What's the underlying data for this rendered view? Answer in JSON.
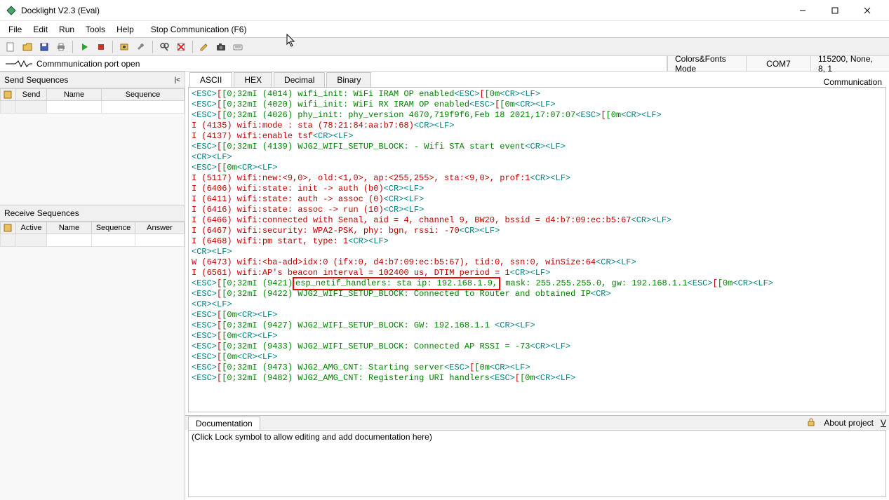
{
  "window": {
    "title": "Docklight V2.3 (Eval)"
  },
  "menubar": [
    "File",
    "Edit",
    "Run",
    "Tools",
    "Help"
  ],
  "stop_comm": "Stop Communication  (F6)",
  "status": {
    "port_open": "Commmunication port open",
    "colors_mode": "Colors&Fonts Mode",
    "port": "COM7",
    "settings": "115200, None, 8, 1"
  },
  "left": {
    "send_header": "Send Sequences",
    "recv_header": "Receive Sequences",
    "send_cols": {
      "c1": "Send",
      "c2": "Name",
      "c3": "Sequence"
    },
    "recv_cols": {
      "c1": "Active",
      "c2": "Name",
      "c3": "Sequence",
      "c4": "Answer"
    }
  },
  "tabs": [
    "ASCII",
    "HEX",
    "Decimal",
    "Binary"
  ],
  "active_tab": 0,
  "right_label": "Communication",
  "doc": {
    "tab": "Documentation",
    "about": "About project",
    "v": "V",
    "placeholder": "(Click Lock symbol to allow editing and add documentation here)"
  },
  "log": [
    {
      "segments": [
        {
          "t": "<ESC>",
          "c": "cyan"
        },
        {
          "t": "[",
          "c": "red"
        },
        {
          "t": "[0;32mI (4014) wifi_init: WiFi IRAM OP enabled",
          "c": "green"
        },
        {
          "t": "<ESC>",
          "c": "cyan"
        },
        {
          "t": "[",
          "c": "red"
        },
        {
          "t": "[0m",
          "c": "green"
        },
        {
          "t": "<CR><LF>",
          "c": "cyan"
        }
      ]
    },
    {
      "segments": [
        {
          "t": "<ESC>",
          "c": "cyan"
        },
        {
          "t": "[",
          "c": "red"
        },
        {
          "t": "[0;32mI (4020) wifi_init: WiFi RX IRAM OP enabled",
          "c": "green"
        },
        {
          "t": "<ESC>",
          "c": "cyan"
        },
        {
          "t": "[",
          "c": "red"
        },
        {
          "t": "[0m",
          "c": "green"
        },
        {
          "t": "<CR><LF>",
          "c": "cyan"
        }
      ]
    },
    {
      "segments": [
        {
          "t": "<ESC>",
          "c": "cyan"
        },
        {
          "t": "[",
          "c": "red"
        },
        {
          "t": "[0;32mI (4026) phy_init: phy_version 4670,719f9f6,Feb 18 2021,17:07:07",
          "c": "green"
        },
        {
          "t": "<ESC>",
          "c": "cyan"
        },
        {
          "t": "[",
          "c": "red"
        },
        {
          "t": "[0m",
          "c": "green"
        },
        {
          "t": "<CR><LF>",
          "c": "cyan"
        }
      ]
    },
    {
      "segments": [
        {
          "t": "I (4135) wifi:mode : sta (78:21:84:aa:b7:68)",
          "c": "red"
        },
        {
          "t": "<CR><LF>",
          "c": "cyan"
        }
      ]
    },
    {
      "segments": [
        {
          "t": "I (4137) wifi:enable tsf",
          "c": "red"
        },
        {
          "t": "<CR><LF>",
          "c": "cyan"
        }
      ]
    },
    {
      "segments": [
        {
          "t": "<ESC>",
          "c": "cyan"
        },
        {
          "t": "[",
          "c": "red"
        },
        {
          "t": "[0;32mI (4139) WJG2_WIFI_SETUP_BLOCK: - Wifi STA start event",
          "c": "green"
        },
        {
          "t": "<CR><LF>",
          "c": "cyan"
        }
      ]
    },
    {
      "segments": [
        {
          "t": "<CR><LF>",
          "c": "cyan"
        }
      ]
    },
    {
      "segments": [
        {
          "t": "<ESC>",
          "c": "cyan"
        },
        {
          "t": "[",
          "c": "red"
        },
        {
          "t": "[0m",
          "c": "green"
        },
        {
          "t": "<CR><LF>",
          "c": "cyan"
        }
      ]
    },
    {
      "segments": [
        {
          "t": "I (5117) wifi:new:<9,0>, old:<1,0>, ap:<255,255>, sta:<9,0>, prof:1",
          "c": "red"
        },
        {
          "t": "<CR><LF>",
          "c": "cyan"
        }
      ]
    },
    {
      "segments": [
        {
          "t": "I (6406) wifi:state: init -> auth (b0)",
          "c": "red"
        },
        {
          "t": "<CR><LF>",
          "c": "cyan"
        }
      ]
    },
    {
      "segments": [
        {
          "t": "I (6411) wifi:state: auth -> assoc (0)",
          "c": "red"
        },
        {
          "t": "<CR><LF>",
          "c": "cyan"
        }
      ]
    },
    {
      "segments": [
        {
          "t": "I (6416) wifi:state: assoc -> run (10)",
          "c": "red"
        },
        {
          "t": "<CR><LF>",
          "c": "cyan"
        }
      ]
    },
    {
      "segments": [
        {
          "t": "I (6466) wifi:connected with Senal, aid = 4, channel 9, BW20, bssid = d4:b7:09:ec:b5:67",
          "c": "red"
        },
        {
          "t": "<CR><LF>",
          "c": "cyan"
        }
      ]
    },
    {
      "segments": [
        {
          "t": "I (6467) wifi:security: WPA2-PSK, phy: bgn, rssi: -70",
          "c": "red"
        },
        {
          "t": "<CR><LF>",
          "c": "cyan"
        }
      ]
    },
    {
      "segments": [
        {
          "t": "I (6468) wifi:pm start, type: 1",
          "c": "red"
        },
        {
          "t": "<CR><LF>",
          "c": "cyan"
        }
      ]
    },
    {
      "segments": [
        {
          "t": "<CR><LF>",
          "c": "cyan"
        }
      ]
    },
    {
      "segments": [
        {
          "t": "W (6473) wifi:<ba-add>idx:0 (ifx:0, d4:b7:09:ec:b5:67), tid:0, ssn:0, winSize:64",
          "c": "red"
        },
        {
          "t": "<CR><LF>",
          "c": "cyan"
        }
      ]
    },
    {
      "segments": [
        {
          "t": "I (6561) wifi:AP's beacon interval = 102400 us, DTIM period = 1",
          "c": "red"
        },
        {
          "t": "<CR><LF>",
          "c": "cyan"
        }
      ]
    },
    {
      "segments": [
        {
          "t": "<ESC>",
          "c": "cyan"
        },
        {
          "t": "[",
          "c": "red"
        },
        {
          "t": "[0;32mI (9421)",
          "c": "green"
        },
        {
          "t": " esp_netif_handlers: sta ip: 192.168.1.9,",
          "c": "green",
          "box": true
        },
        {
          "t": " mask: 255.255.255.0, gw: 192.168.1.1",
          "c": "green"
        },
        {
          "t": "<ESC>",
          "c": "cyan"
        },
        {
          "t": "[",
          "c": "red"
        },
        {
          "t": "[0m",
          "c": "green"
        },
        {
          "t": "<CR><LF>",
          "c": "cyan"
        }
      ]
    },
    {
      "segments": [
        {
          "t": "<ESC>",
          "c": "cyan"
        },
        {
          "t": "[",
          "c": "red"
        },
        {
          "t": "[0;32mI (9422) WJG2_WIFI_SETUP_BLOCK: Connected to Router and obtained IP",
          "c": "green"
        },
        {
          "t": "<CR>",
          "c": "cyan"
        }
      ]
    },
    {
      "segments": [
        {
          "t": "<CR><LF>",
          "c": "cyan"
        }
      ]
    },
    {
      "segments": [
        {
          "t": "<ESC>",
          "c": "cyan"
        },
        {
          "t": "[",
          "c": "red"
        },
        {
          "t": "[0m",
          "c": "green"
        },
        {
          "t": "<CR><LF>",
          "c": "cyan"
        }
      ]
    },
    {
      "segments": [
        {
          "t": "<ESC>",
          "c": "cyan"
        },
        {
          "t": "[",
          "c": "red"
        },
        {
          "t": "[0;32mI (9427) WJG2_WIFI_SETUP_BLOCK: GW: 192.168.1.1 ",
          "c": "green"
        },
        {
          "t": "<CR><LF>",
          "c": "cyan"
        }
      ]
    },
    {
      "segments": [
        {
          "t": "<ESC>",
          "c": "cyan"
        },
        {
          "t": "[",
          "c": "red"
        },
        {
          "t": "[0m",
          "c": "green"
        },
        {
          "t": "<CR><LF>",
          "c": "cyan"
        }
      ]
    },
    {
      "segments": [
        {
          "t": "<ESC>",
          "c": "cyan"
        },
        {
          "t": "[",
          "c": "red"
        },
        {
          "t": "[0;32mI (9433) WJG2_WIFI_SETUP_BLOCK: Connected AP RSSI = -73",
          "c": "green"
        },
        {
          "t": "<CR><LF>",
          "c": "cyan"
        }
      ]
    },
    {
      "segments": [
        {
          "t": "<ESC>",
          "c": "cyan"
        },
        {
          "t": "[",
          "c": "red"
        },
        {
          "t": "[0m",
          "c": "green"
        },
        {
          "t": "<CR><LF>",
          "c": "cyan"
        }
      ]
    },
    {
      "segments": [
        {
          "t": "<ESC>",
          "c": "cyan"
        },
        {
          "t": "[",
          "c": "red"
        },
        {
          "t": "[0;32mI (9473) WJG2_AMG_CNT: Starting server",
          "c": "green"
        },
        {
          "t": "<ESC>",
          "c": "cyan"
        },
        {
          "t": "[",
          "c": "red"
        },
        {
          "t": "[0m",
          "c": "green"
        },
        {
          "t": "<CR><LF>",
          "c": "cyan"
        }
      ]
    },
    {
      "segments": [
        {
          "t": "<ESC>",
          "c": "cyan"
        },
        {
          "t": "[",
          "c": "red"
        },
        {
          "t": "[0;32mI (9482) WJG2_AMG_CNT: Registering URI handlers",
          "c": "green"
        },
        {
          "t": "<ESC>",
          "c": "cyan"
        },
        {
          "t": "[",
          "c": "red"
        },
        {
          "t": "[0m",
          "c": "green"
        },
        {
          "t": "<CR><LF>",
          "c": "cyan"
        }
      ]
    }
  ]
}
